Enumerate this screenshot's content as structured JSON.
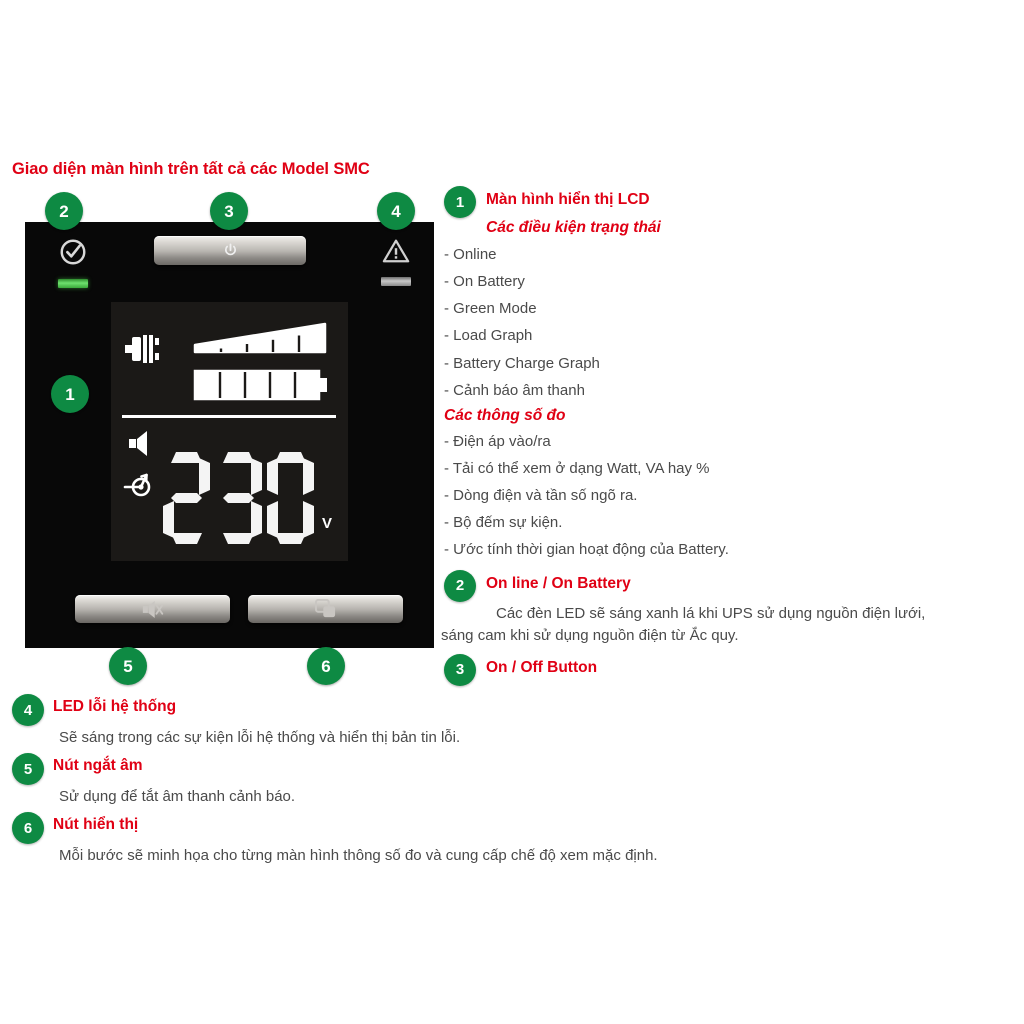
{
  "page": {
    "title": "Giao diện màn hình trên tất cả các Model SMC",
    "accent_red": "#e00014",
    "badge_green": "#0e8a43",
    "body_gray": "#4a4a4a",
    "panel_black": "#080808",
    "lcd_black": "#1b1917"
  },
  "device": {
    "status_ok": {
      "icon": "check-circle-icon",
      "led_color": "#4fd04f"
    },
    "status_fault": {
      "icon": "warning-triangle-icon",
      "led_color": "#b4b4b4"
    },
    "power_button": {
      "icon": "power-icon"
    },
    "lcd": {
      "plug_icon": "power-plug-icon",
      "load_graph": {
        "icon": "load-graph-wedge",
        "segments": 5,
        "filled": 5
      },
      "battery_graph": {
        "icon": "battery-graph",
        "segments": 5,
        "filled": 5
      },
      "mute_icon": "speaker-icon",
      "output_icon": "output-arrow-icon",
      "reading_value": "230",
      "reading_unit": "V",
      "digits": [
        "2",
        "3",
        "0"
      ]
    },
    "mute_button": {
      "icon": "speaker-mute-icon"
    },
    "display_button": {
      "icon": "display-screens-icon"
    },
    "callouts": {
      "top_left": "2",
      "top_center": "3",
      "top_right": "4",
      "lcd": "1",
      "bottom_left": "5",
      "bottom_right": "6"
    }
  },
  "sections": {
    "item1": {
      "number": "1",
      "heading": "Màn hình hiển thị LCD",
      "subheading": "Các điều kiện trạng thái",
      "status_bullets": [
        "- Online",
        "- On Battery",
        "- Green Mode",
        "- Load Graph",
        "- Battery Charge Graph",
        "- Cảnh báo âm thanh"
      ],
      "measure_subheading": "Các thông số đo",
      "measure_bullets": [
        "- Điện áp vào/ra",
        "- Tải có thể xem ở dạng Watt, VA hay %",
        "- Dòng điện và tần số ngõ ra.",
        "- Bộ đếm sự kiện.",
        "- Ước tính thời gian hoạt động của Battery."
      ]
    },
    "item2": {
      "number": "2",
      "heading": "On line / On Battery",
      "body_line1": "Các đèn LED sẽ sáng xanh lá khi UPS sử dụng nguồn điện lưới,",
      "body_line2": "sáng cam khi sử dụng nguồn điện từ Ắc quy."
    },
    "item3": {
      "number": "3",
      "heading": "On / Off Button"
    },
    "item4": {
      "number": "4",
      "heading": "LED lỗi hệ thống",
      "body": "Sẽ sáng trong các sự kiện lỗi hệ thống và hiển thị bản tin lỗi."
    },
    "item5": {
      "number": "5",
      "heading": "Nút ngắt âm",
      "body": "Sử dụng để tắt âm thanh cảnh báo."
    },
    "item6": {
      "number": "6",
      "heading": "Nút hiển thị",
      "body": "Mỗi bước sẽ minh họa cho từng màn hình thông số đo và cung cấp chế độ xem mặc định."
    }
  }
}
